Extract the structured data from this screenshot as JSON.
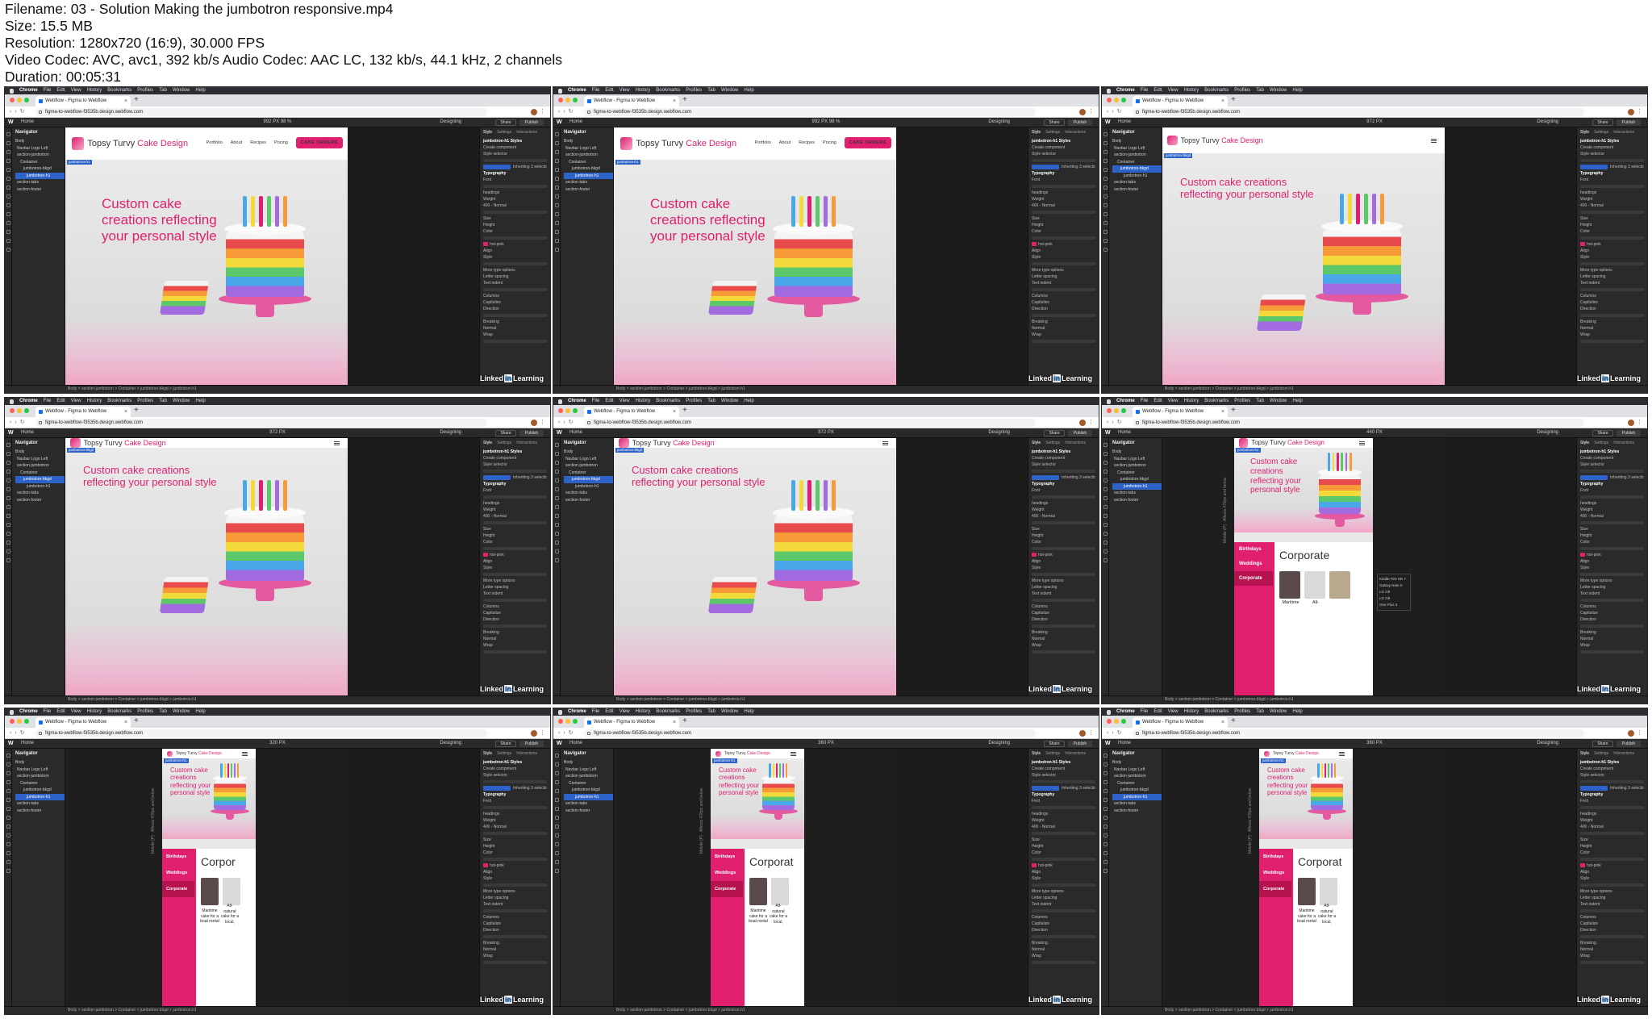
{
  "file_info": {
    "filename": "Filename: 03 - Solution Making the jumbotron responsive.mp4",
    "size": "Size: 15.5 MB",
    "resolution": "Resolution: 1280x720 (16:9), 30.000 FPS",
    "codecs": "Video Codec: AVC, avc1, 392 kb/s Audio Codec: AAC LC, 132 kb/s, 44.1 kHz, 2 channels",
    "duration": "Duration: 00:05:31"
  },
  "common": {
    "menubar": [
      "Chrome",
      "File",
      "Edit",
      "View",
      "History",
      "Bookmarks",
      "Profiles",
      "Tab",
      "Window",
      "Help"
    ],
    "tab_title": "Webflow - Figma to Webflow",
    "url": "figma-to-webflow-f3535b.design.webflow.com",
    "wf_home": "Home",
    "wf_mode": "Designing",
    "wf_share": "Share",
    "wf_publish": "Publish",
    "navigator_title": "Navigator",
    "navigator_items": [
      "Body",
      "Navbar Logo Left",
      "section-jumbotron",
      "Container",
      "jumbotron-bkgd",
      "jumbotron-h1",
      "section-tabs",
      "section-footer"
    ],
    "style_tabs": [
      "Style",
      "Settings",
      "Interactions"
    ],
    "style_lines": [
      "jumbotron-h1 Styles",
      "Create component",
      "Style selector",
      "Inheriting 3 selections",
      "Typography",
      "Font",
      "headings",
      "Weight",
      "400 - Normal",
      "Size",
      "Height",
      "Color",
      "hot-pink",
      "Align",
      "Style",
      "More type options",
      "Letter spacing",
      "Text indent",
      "Columns",
      "Capitalize",
      "Direction",
      "Breaking",
      "Normal",
      "Wrap"
    ],
    "breadcrumbs": "Body  >  section-jumbotron  >  Container  >  jumbotron-bkgd  >  jumbotron-h1",
    "brand_part1": "Topsy Turvy",
    "brand_part2": "Cake Design",
    "nav_links": [
      "Portfolio",
      "About",
      "Recipes",
      "Pricing"
    ],
    "cta": "CAKE ORDERS",
    "hero_title": "Custom cake creations reflecting your personal style",
    "selection_tag": "jumbotron-h1",
    "selection_tag_bkgd": "jumbotron-bkgd",
    "tabs": [
      "Birthdays",
      "Weddings",
      "Corporate"
    ],
    "tab_heading": "Corporate",
    "tab_heading_cut": "Corpor",
    "tab_heading_cut2": "Corporat",
    "captions": [
      "Maritime",
      "All-"
    ],
    "caption_long": "Maritime cake for a boat rental",
    "caption_long2": "All-natural cake for a local,",
    "device_menu": [
      "Kindle Fire HD 7",
      "Galaxy Note 5",
      "LG G5",
      "LG G6",
      "One Plus 3"
    ],
    "linkedin_a": "Linked",
    "linkedin_in": "in",
    "linkedin_b": "Learning",
    "vertical_label": "Mobile (P) · Affects 478px and below",
    "colors": {
      "hot_pink": "#e0206f",
      "webflow_blue": "#2d62c8",
      "panel": "#2a2a2a"
    }
  },
  "thumbnails": [
    {
      "width_label": "992 PX  98 %",
      "variant": "desktop"
    },
    {
      "width_label": "992 PX  98 %",
      "variant": "desktop"
    },
    {
      "width_label": "972 PX",
      "variant": "tablet"
    },
    {
      "width_label": "972 PX",
      "variant": "tablet-scrolled"
    },
    {
      "width_label": "972 PX",
      "variant": "tablet-scrolled"
    },
    {
      "width_label": "440 PX",
      "variant": "landscape"
    },
    {
      "width_label": "320 PX",
      "variant": "mobile"
    },
    {
      "width_label": "360 PX",
      "variant": "mobile"
    },
    {
      "width_label": "360 PX",
      "variant": "mobile"
    }
  ]
}
